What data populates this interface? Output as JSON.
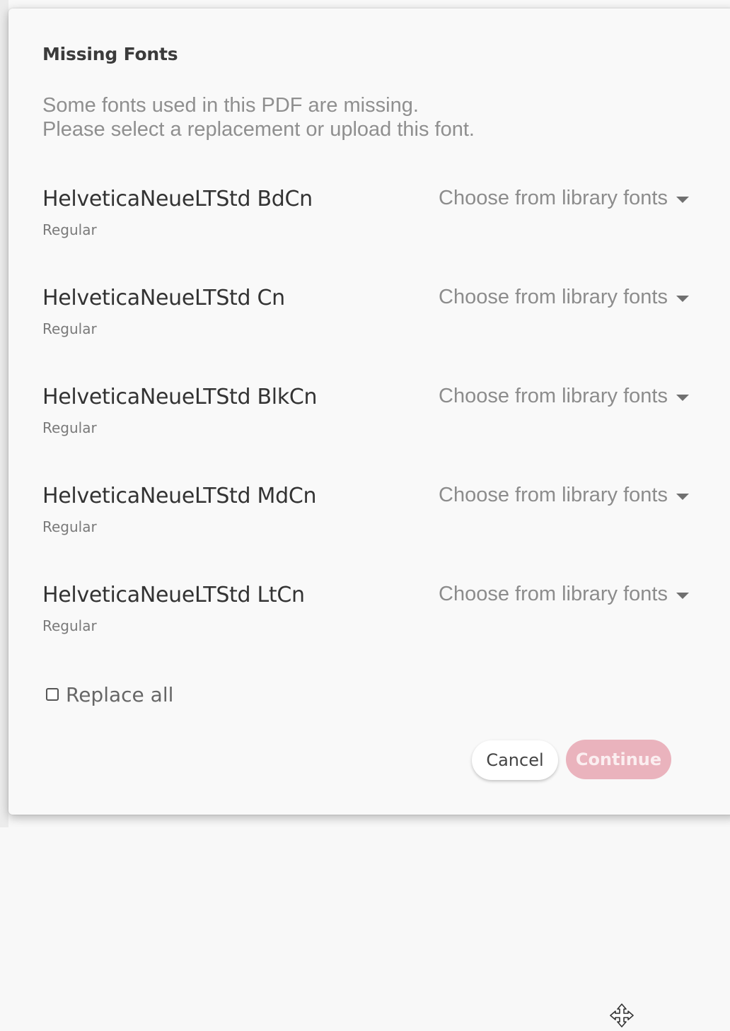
{
  "dialog": {
    "title": "Missing Fonts",
    "description_line1": "Some fonts used in this PDF are missing.",
    "description_line2": "Please select a replacement or upload this font.",
    "fonts": [
      {
        "name": "HelveticaNeueLTStd BdCn",
        "style": "Regular",
        "select_label": "Choose from library fonts"
      },
      {
        "name": "HelveticaNeueLTStd Cn",
        "style": "Regular",
        "select_label": "Choose from library fonts"
      },
      {
        "name": "HelveticaNeueLTStd BlkCn",
        "style": "Regular",
        "select_label": "Choose from library fonts"
      },
      {
        "name": "HelveticaNeueLTStd MdCn",
        "style": "Regular",
        "select_label": "Choose from library fonts"
      },
      {
        "name": "HelveticaNeueLTStd LtCn",
        "style": "Regular",
        "select_label": "Choose from library fonts"
      }
    ],
    "replace_all_label": "Replace all",
    "replace_all_checked": false,
    "cancel_label": "Cancel",
    "continue_label": "Continue",
    "continue_enabled": false
  },
  "colors": {
    "continue_disabled_bg": "#eab3bd",
    "continue_text": "#fbeef0",
    "dialog_bg": "#f9f9f9"
  },
  "icons": {
    "dropdown": "caret-down-icon",
    "cursor": "move-cursor-icon"
  }
}
